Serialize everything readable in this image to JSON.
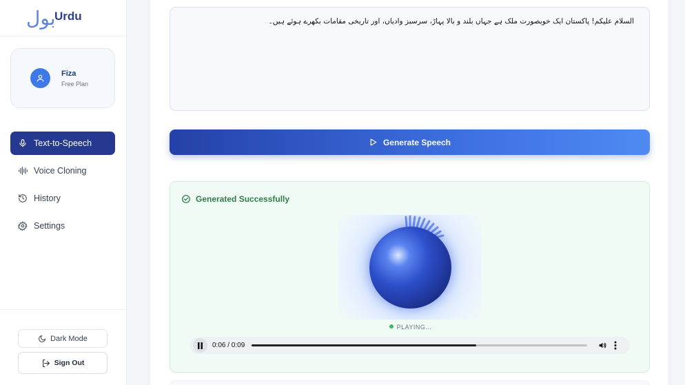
{
  "brand": {
    "urdu_mark": "بول",
    "name": "Urdu"
  },
  "user": {
    "name": "Fiza",
    "plan": "Free Plan"
  },
  "nav": [
    {
      "label": "Text-to-Speech",
      "icon": "mic-icon",
      "active": true
    },
    {
      "label": "Voice Cloning",
      "icon": "waveform-icon",
      "active": false
    },
    {
      "label": "History",
      "icon": "history-icon",
      "active": false
    },
    {
      "label": "Settings",
      "icon": "gear-icon",
      "active": false
    }
  ],
  "footer": {
    "dark_mode_label": "Dark Mode",
    "sign_out_label": "Sign Out"
  },
  "editor": {
    "text": "السلام علیکم! پاکستان ایک خوبصورت ملک ہے جہاں بلند و بالا پہاڑ، سرسبز وادیاں، اور تاریخی مقامات بکھرے ہوئے ہیں۔"
  },
  "generate": {
    "label": "Generate Speech"
  },
  "result": {
    "title": "Generated Successfully",
    "status": "PLAYING...",
    "player": {
      "time": "0:06 / 0:09",
      "progress": 0.67
    }
  },
  "colors": {
    "primary": "#24398f",
    "accent": "#3f79e8",
    "success": "#2e7d46"
  }
}
